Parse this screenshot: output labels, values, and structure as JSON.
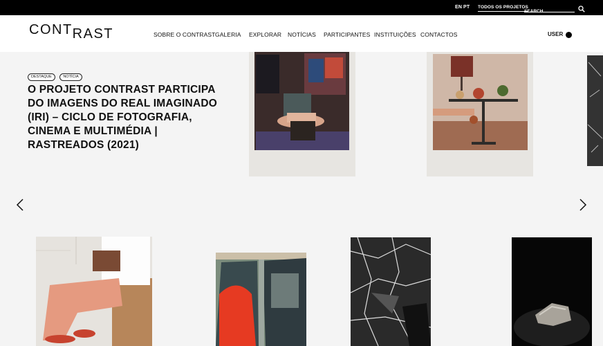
{
  "topbar": {
    "lang_en": "EN",
    "lang_pt": "PT",
    "all_projects": "TODOS OS PROJETOS",
    "search_placeholder": "SEARCH"
  },
  "header": {
    "logo_part1": "CONT",
    "logo_part2": "RAST",
    "nav": [
      "SOBRE O CONTRAST",
      "GALERIA",
      "EXPLORAR",
      "NOTÍCIAS",
      "PARTICIPANTES",
      "INSTITUIÇÕES",
      "CONTACTOS"
    ],
    "user_label": "USER"
  },
  "hero": {
    "tags": [
      "DESTAQUE",
      "NOTÍCIA"
    ],
    "headline": "O PROJETO CONTRAST PARTICIPA DO IMAGENS DO REAL IMAGINADO (IRI) – CICLO DE FOTOGRAFIA, CINEMA E MULTIMÉDIA | RASTREADOS (2021)"
  },
  "icons": {
    "search": "search-icon",
    "prev": "chevron-left-icon",
    "next": "chevron-right-icon",
    "user": "user-dot-icon"
  },
  "colors": {
    "topbar": "#000000",
    "header": "#ffffff",
    "page": "#f4f4f4"
  }
}
